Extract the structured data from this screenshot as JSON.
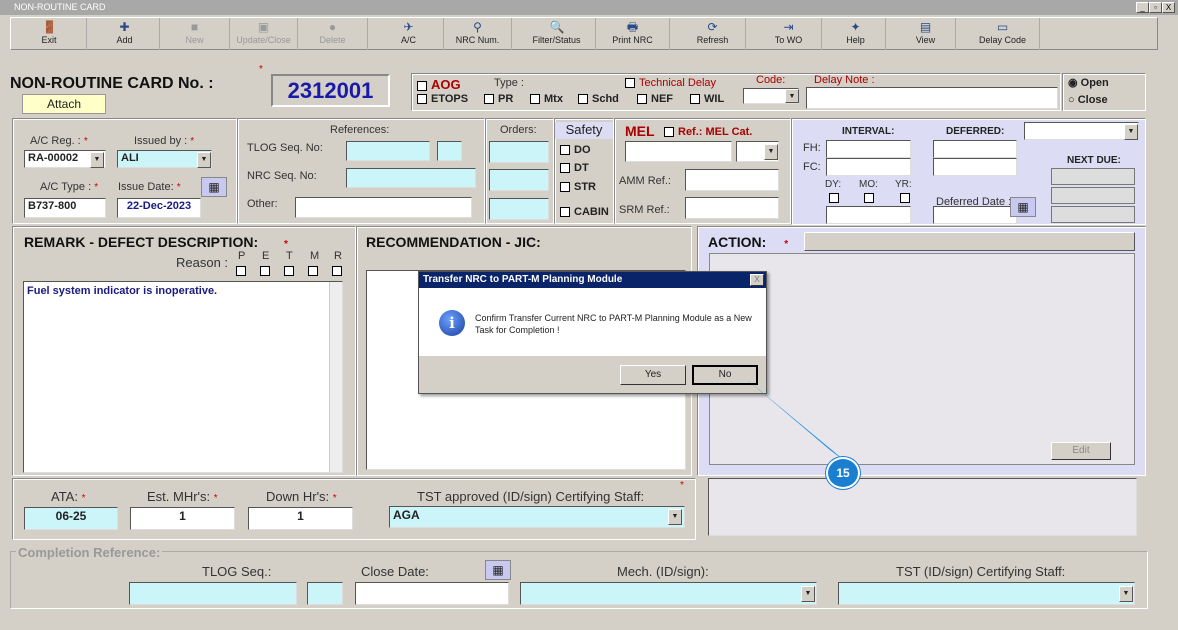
{
  "window": {
    "title": "NON-ROUTINE CARD",
    "min": "_",
    "max": "▫",
    "close": "X"
  },
  "toolbar": [
    {
      "label": "Exit",
      "icon": "exit-icon",
      "glyph": "🚪",
      "enabled": true
    },
    {
      "label": "Add",
      "icon": "add-icon",
      "glyph": "✚",
      "enabled": true
    },
    {
      "label": "New",
      "icon": "new-icon",
      "glyph": "■",
      "enabled": false
    },
    {
      "label": "Update/Close",
      "icon": "save-icon",
      "glyph": "▣",
      "enabled": false
    },
    {
      "label": "Delete",
      "icon": "delete-icon",
      "glyph": "●",
      "enabled": false
    },
    {
      "label": "A/C",
      "icon": "aircraft-icon",
      "glyph": "✈",
      "enabled": true
    },
    {
      "label": "NRC Num.",
      "icon": "nrc-search-icon",
      "glyph": "⚲",
      "enabled": true
    },
    {
      "label": "Filter/Status",
      "icon": "magnifier-icon",
      "glyph": "🔍",
      "enabled": true
    },
    {
      "label": "Print NRC",
      "icon": "printer-icon",
      "glyph": "🖶",
      "enabled": true
    },
    {
      "label": "Refresh",
      "icon": "refresh-icon",
      "glyph": "⟳",
      "enabled": true
    },
    {
      "label": "To WO",
      "icon": "to-wo-icon",
      "glyph": "⇥",
      "enabled": true
    },
    {
      "label": "Help",
      "icon": "help-icon",
      "glyph": "✦",
      "enabled": true
    },
    {
      "label": "View",
      "icon": "view-icon",
      "glyph": "▤",
      "enabled": true
    },
    {
      "label": "Delay Code",
      "icon": "delay-code-icon",
      "glyph": "▭",
      "enabled": true
    }
  ],
  "header": {
    "title": "NON-ROUTINE CARD No. :",
    "attach": "Attach",
    "card_no": "2312001",
    "aog": "AOG",
    "type_label": "Type :",
    "etops": "ETOPS",
    "pr": "PR",
    "mtx": "Mtx",
    "schd": "Schd",
    "nef": "NEF",
    "wil": "WIL",
    "technical_delay": "Technical Delay",
    "code_label": "Code:",
    "delay_note_label": "Delay Note :",
    "open": "Open",
    "close": "Close"
  },
  "aircraft": {
    "ac_reg_label": "A/C Reg. :",
    "ac_reg": "RA-00002",
    "issued_by_label": "Issued by :",
    "issued_by": "ALI",
    "ac_type_label": "A/C Type :",
    "ac_type": "B737-800",
    "issue_date_label": "Issue Date:",
    "issue_date": "22-Dec-2023"
  },
  "references": {
    "title": "References:",
    "tlog": "TLOG Seq. No:",
    "nrc": "NRC Seq. No:",
    "other": "Other:"
  },
  "orders": {
    "title": "Orders:"
  },
  "safety": {
    "title": "Safety",
    "do": "DO",
    "dt": "DT",
    "str": "STR",
    "cabin": "CABIN"
  },
  "mel": {
    "title": "MEL",
    "ref": "Ref.: MEL Cat.",
    "amm": "AMM Ref.:",
    "srm": "SRM Ref.:"
  },
  "interval": {
    "title": "INTERVAL:",
    "fh": "FH:",
    "fc": "FC:",
    "dy": "DY:",
    "mo": "MO:",
    "yr": "YR:",
    "deferred": "DEFERRED:",
    "deferred_date": "Deferred Date :",
    "next_due": "NEXT DUE:"
  },
  "remark": {
    "title": "REMARK - DEFECT DESCRIPTION:",
    "reason": "Reason :",
    "reasons": [
      "P",
      "E",
      "T",
      "M",
      "R"
    ],
    "text": "Fuel system indicator is inoperative."
  },
  "recommendation": {
    "title": "RECOMMENDATION - JIC:"
  },
  "action": {
    "title": "ACTION:",
    "edit": "Edit"
  },
  "bottom": {
    "ata_label": "ATA:",
    "ata": "06-25",
    "est_label": "Est. MHr's:",
    "est": "1",
    "down_label": "Down Hr's:",
    "down": "1",
    "tst_label": "TST approved (ID/sign) Certifying Staff:",
    "tst": "AGA"
  },
  "completion": {
    "title": "Completion Reference:",
    "tlog": "TLOG Seq.:",
    "close_date": "Close Date:",
    "mech": "Mech. (ID/sign):",
    "tst": "TST (ID/sign) Certifying Staff:"
  },
  "dialog": {
    "title": "Transfer NRC to PART-M Planning Module",
    "message": "Confirm Transfer Current NRC to PART-M Planning Module as a New Task for Completion !",
    "yes": "Yes",
    "no": "No",
    "close": "X"
  },
  "callout": {
    "step": "15"
  }
}
